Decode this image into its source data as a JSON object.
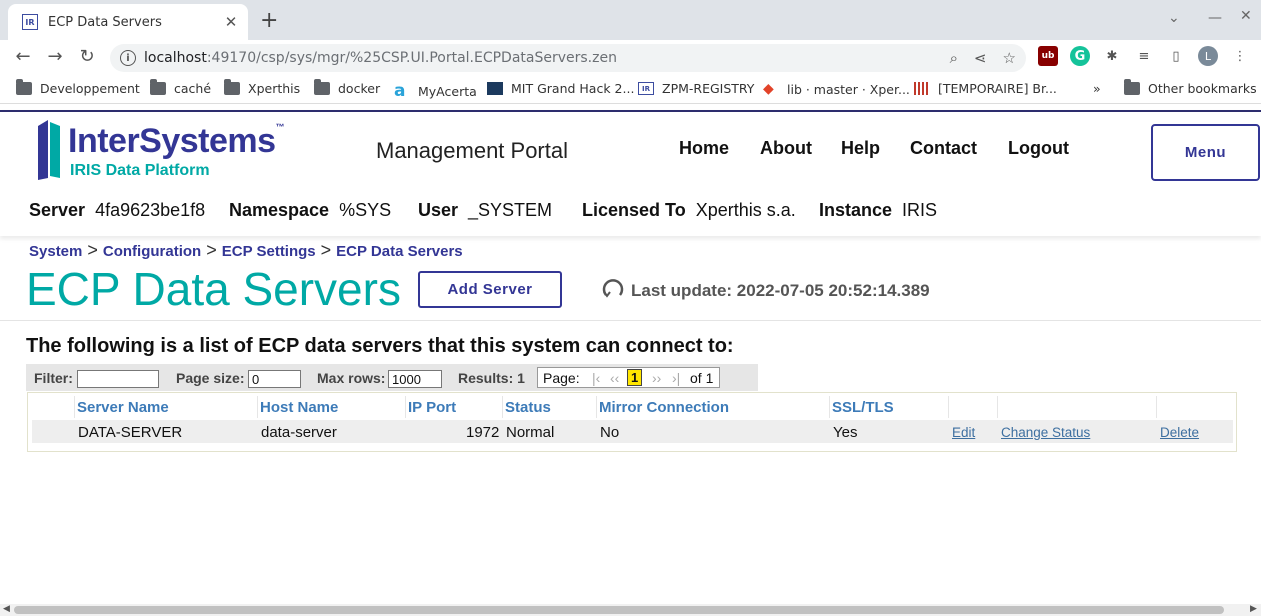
{
  "browser": {
    "tab_title": "ECP Data Servers",
    "tab_favicon": "IR",
    "url_host": "localhost",
    "url_path": ":49170/csp/sys/mgr/%25CSP.UI.Portal.ECPDataServers.zen",
    "profile_initial": "L",
    "bookmarks": [
      {
        "label": "Developpement",
        "icon": "folder-icon"
      },
      {
        "label": "caché",
        "icon": "folder-icon"
      },
      {
        "label": "Xperthis",
        "icon": "folder-icon"
      },
      {
        "label": "docker",
        "icon": "folder-icon"
      },
      {
        "label": "MyAcerta",
        "icon": "acerta-icon"
      },
      {
        "label": "MIT Grand Hack 2...",
        "icon": "mit-icon"
      },
      {
        "label": "ZPM-REGISTRY",
        "icon": "iris-icon"
      },
      {
        "label": "lib · master · Xper...",
        "icon": "gitlab-icon"
      },
      {
        "label": "[TEMPORAIRE] Br...",
        "icon": "bars-icon"
      }
    ],
    "overflow": "»",
    "other_bookmarks": "Other bookmarks"
  },
  "header": {
    "brand": "InterSystems",
    "brand_tm": "™",
    "platform": "IRIS Data Platform",
    "portal_title": "Management Portal",
    "nav": [
      "Home",
      "About",
      "Help",
      "Contact",
      "Logout"
    ],
    "menu": "Menu",
    "context": {
      "server_label": "Server",
      "server": "4fa9623be1f8",
      "namespace_label": "Namespace",
      "namespace": "%SYS",
      "user_label": "User",
      "user": "_SYSTEM",
      "licensed_label": "Licensed To",
      "licensed": "Xperthis s.a.",
      "instance_label": "Instance",
      "instance": "IRIS"
    }
  },
  "breadcrumb": [
    "System",
    "Configuration",
    "ECP Settings",
    "ECP Data Servers"
  ],
  "page": {
    "title": "ECP Data Servers",
    "add_button": "Add Server",
    "last_update": "Last update: 2022-07-05 20:52:14.389",
    "description": "The following is a list of ECP data servers that this system can connect to:"
  },
  "filters": {
    "filter_label": "Filter:",
    "filter_value": "",
    "page_size_label": "Page size:",
    "page_size": "0",
    "max_rows_label": "Max rows:",
    "max_rows": "1000",
    "results": "Results: 1",
    "page_label": "Page:",
    "current_page": "1",
    "of_pages": "of 1"
  },
  "table": {
    "headers": [
      "Server Name",
      "Host Name",
      "IP Port",
      "Status",
      "Mirror Connection",
      "SSL/TLS"
    ],
    "rows": [
      {
        "server_name": "DATA-SERVER",
        "host_name": "data-server",
        "ip_port": "1972",
        "status": "Normal",
        "mirror": "No",
        "ssl": "Yes",
        "edit": "Edit",
        "change_status": "Change Status",
        "delete": "Delete"
      }
    ]
  },
  "colors": {
    "brand": "#333695",
    "accent": "#00a9a5",
    "link": "#3d7bb8"
  }
}
